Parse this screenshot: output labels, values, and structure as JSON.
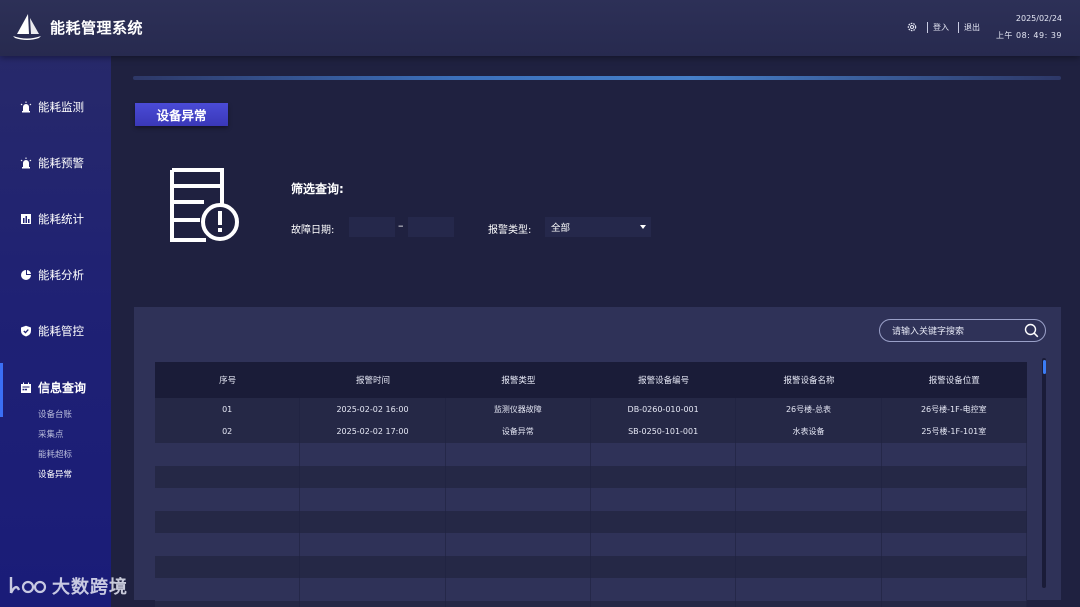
{
  "header": {
    "title": "能耗管理系统",
    "login_label": "登入",
    "logout_label": "退出",
    "date": "2025/02/24",
    "time": "上午  08: 49: 39"
  },
  "sidebar": {
    "items": [
      {
        "label": "能耗监测",
        "icon": "alarm-light-icon"
      },
      {
        "label": "能耗预警",
        "icon": "alarm-light-icon"
      },
      {
        "label": "能耗统计",
        "icon": "bar-chart-icon"
      },
      {
        "label": "能耗分析",
        "icon": "pie-chart-icon"
      },
      {
        "label": "能耗管控",
        "icon": "shield-icon"
      }
    ],
    "active": {
      "label": "信息查询",
      "icon": "calendar-icon"
    },
    "sub_items": [
      "设备台账",
      "采集点",
      "能耗超标",
      "设备异常"
    ],
    "current_sub": "设备异常"
  },
  "page": {
    "tab_label": "设备异常",
    "filter_title": "筛选查询:",
    "fault_date_label": "故障日期:",
    "date_from": "",
    "date_to": "",
    "date_dash": "–",
    "alarm_type_label": "报警类型:",
    "alarm_type_value": "全部"
  },
  "search": {
    "placeholder": "请输入关键字搜索"
  },
  "table": {
    "columns": [
      "序号",
      "报警时间",
      "报警类型",
      "报警设备编号",
      "报警设备名称",
      "报警设备位置"
    ],
    "rows": [
      [
        "01",
        "2025-02-02  16:00",
        "监测仪器故障",
        "DB-0260-010-001",
        "26号楼-总表",
        "26号楼-1F-电控室"
      ],
      [
        "02",
        "2025-02-02  17:00",
        "设备异常",
        "SB-0250-101-001",
        "水表设备",
        "25号楼-1F-101室"
      ]
    ]
  },
  "watermark": {
    "text": "大数跨境"
  },
  "colors": {
    "background": "#1f2140",
    "header": "#2b2e55",
    "sidebar": "#1f2174",
    "accent": "#3b6ff5",
    "tab": "#4a4bd6",
    "panel": "#2f3258"
  }
}
